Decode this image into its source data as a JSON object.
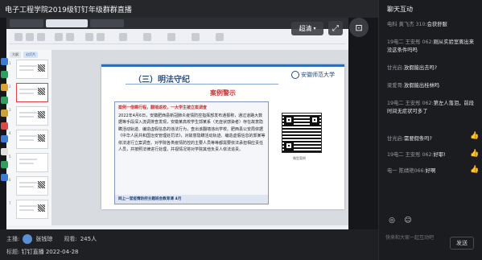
{
  "window": {
    "title": "电子工程学院2019级钉钉年级群群直播",
    "minimize": "—",
    "maximize": "□",
    "close": "✕"
  },
  "video": {
    "quality_label": "超清",
    "quality_caret": "▾",
    "fullscreen_glyph": "⤢",
    "float_glyph": "⊡"
  },
  "slide": {
    "thumbs_tabs": [
      "大纲",
      "幻灯片"
    ],
    "thumb_numbers": [
      "1",
      "2",
      "3",
      "4",
      "5",
      "6",
      "7"
    ],
    "logo_text": "安徽师范大学",
    "heading": "（三）明法守纪",
    "subheading": "案例警示",
    "case_title": "案例一借瞒行程，翻墙返校，一大学生被立案调查",
    "body": "2022年4月6日，安徽肥西县新冠肺炎疫情防控指挥部发布通报称，通过道路大数据等手段深入流调排查发现，安徽某高校学生郭某系（无症状感染者）存在故意隐瞒活动轨迹、编造虚假信息的违法行为，查出该翻墙违出学校。肥西县公安局依据《中华人民共和国治安管理处罚法》，对故意隐瞒活动轨迹、编造虚假信息的郭某等依法进行立案调查。对学院各类疫情防控的主要人员等等都需要依法承担相应责任人员，并按照法律进行处理，并视情况将对学院其他负责人依法追责。",
    "footer": "同上一堂疫情防控主题班会教育课 4月",
    "qr_caption": "微型案例"
  },
  "info": {
    "host_label": "主播:",
    "host_name": "张钱琼",
    "viewers_label": "观看:",
    "viewers_value": "245人",
    "topic_label": "标题:",
    "topic_value": "钉钉直播 2022-04-28"
  },
  "chat": {
    "title": "聊天互动",
    "messages": [
      {
        "who": "电科 黄飞杰 310:",
        "text": "会获舒服"
      },
      {
        "who": "19电二 王安彤 062:",
        "text": "刚从实验室离出来没这条件吗吗"
      },
      {
        "who": "甘光启:",
        "text": "放假能出去吗?"
      },
      {
        "who": "梁爱哥:",
        "text": "放假能出桂林吗"
      },
      {
        "who": "19电二 王安彤 062:",
        "text": "第左人落泪，前段时间无症状可多了"
      },
      {
        "who": "甘光启:",
        "text": "需要假条吗?"
      },
      {
        "who": "19电二 王安彤 062:",
        "text": "好耶!"
      },
      {
        "who": "电一 陈靖艳066:",
        "text": "好啊"
      }
    ],
    "input_placeholder": "快来和大家一起互动吧",
    "send_label": "发送",
    "tool_icons": [
      "◎",
      "☺"
    ]
  }
}
